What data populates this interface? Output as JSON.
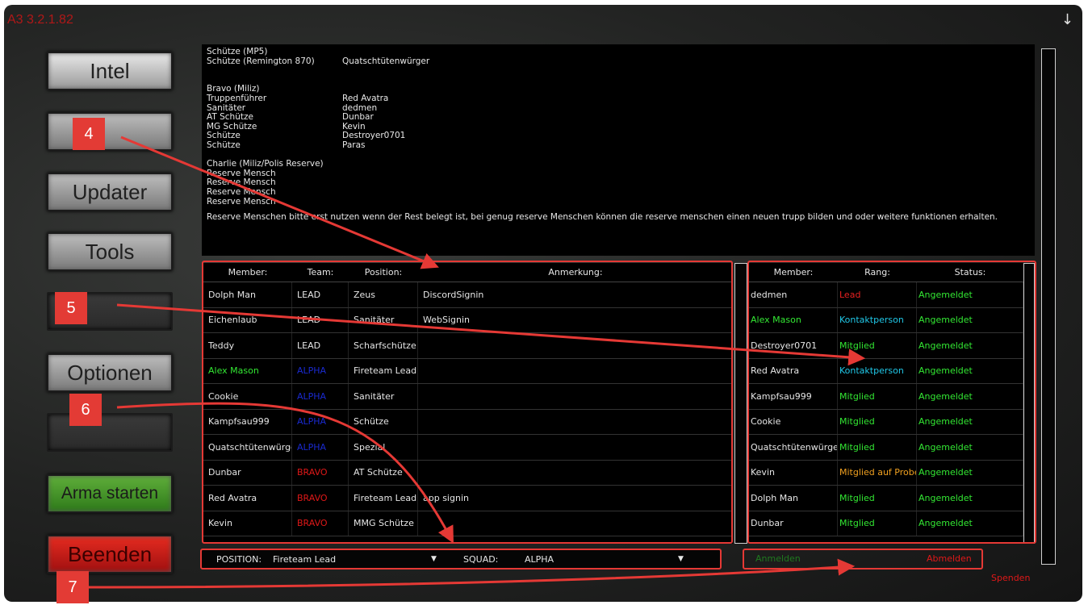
{
  "app": {
    "version": "A3 3.2.1.82"
  },
  "sidebar": [
    {
      "label": "Intel",
      "style": "light"
    },
    {
      "label": "",
      "style": "grey"
    },
    {
      "label": "Updater",
      "style": "grey"
    },
    {
      "label": "Tools",
      "style": "grey"
    },
    {
      "label": "",
      "style": "dark"
    },
    {
      "label": "Optionen",
      "style": "grey"
    },
    {
      "label": "",
      "style": "dark"
    },
    {
      "label": "Arma starten",
      "style": "green"
    },
    {
      "label": "Beenden",
      "style": "red"
    }
  ],
  "badges": [
    "4",
    "5",
    "6",
    "7"
  ],
  "info": {
    "lines": [
      {
        "role": "Schütze (MP5)",
        "name": ""
      },
      {
        "role": "Schütze (Remington 870)",
        "name": "Quatschtütenwürger"
      },
      {
        "role": "",
        "name": ""
      },
      {
        "role": "",
        "name": ""
      },
      {
        "role": "Bravo (Miliz)",
        "name": ""
      },
      {
        "role": "Truppenführer",
        "name": "Red Avatra"
      },
      {
        "role": "Sanitäter",
        "name": "dedmen"
      },
      {
        "role": "AT Schütze",
        "name": "Dunbar"
      },
      {
        "role": "MG Schütze",
        "name": "Kevin"
      },
      {
        "role": "Schütze",
        "name": "Destroyer0701"
      },
      {
        "role": "Schütze",
        "name": "Paras"
      },
      {
        "role": "",
        "name": ""
      },
      {
        "role": "Charlie (Miliz/Polis Reserve)",
        "name": ""
      },
      {
        "role": "Reserve Mensch",
        "name": ""
      },
      {
        "role": "Reserve Mensch",
        "name": ""
      },
      {
        "role": "Reserve Mensch",
        "name": ""
      },
      {
        "role": "Reserve Mensch",
        "name": ""
      }
    ],
    "note": "Reserve Menschen bitte erst nutzen wenn der Rest belegt ist, bei genug reserve Menschen können die reserve menschen einen neuen trupp bilden und oder weitere funktionen erhalten."
  },
  "roster": {
    "headers": [
      "Member:",
      "Team:",
      "Position:",
      "Anmerkung:"
    ],
    "rows": [
      {
        "member": "Dolph Man",
        "member_color": "#e6e6e6",
        "team": "LEAD",
        "team_color": "#e6e6e6",
        "position": "Zeus",
        "note": "DiscordSignin"
      },
      {
        "member": "Eichenlaub",
        "member_color": "#e6e6e6",
        "team": "LEAD",
        "team_color": "#e6e6e6",
        "position": "Sanitäter",
        "note": "WebSignin"
      },
      {
        "member": "Teddy",
        "member_color": "#e6e6e6",
        "team": "LEAD",
        "team_color": "#e6e6e6",
        "position": "Scharfschütze",
        "note": ""
      },
      {
        "member": "Alex Mason",
        "member_color": "#33e833",
        "team": "ALPHA",
        "team_color": "#1a2ad0",
        "position": "Fireteam Lead",
        "note": ""
      },
      {
        "member": "Cookie",
        "member_color": "#e6e6e6",
        "team": "ALPHA",
        "team_color": "#1a2ad0",
        "position": "Sanitäter",
        "note": ""
      },
      {
        "member": "Kampfsau999",
        "member_color": "#e6e6e6",
        "team": "ALPHA",
        "team_color": "#1a2ad0",
        "position": "Schütze",
        "note": ""
      },
      {
        "member": "Quatschtütenwürger",
        "member_color": "#e6e6e6",
        "team": "ALPHA",
        "team_color": "#1a2ad0",
        "position": "Spezial",
        "note": ""
      },
      {
        "member": "Dunbar",
        "member_color": "#e6e6e6",
        "team": "BRAVO",
        "team_color": "#e01818",
        "position": "AT Schütze",
        "note": ""
      },
      {
        "member": "Red Avatra",
        "member_color": "#e6e6e6",
        "team": "BRAVO",
        "team_color": "#e01818",
        "position": "Fireteam Lead",
        "note": "app signin"
      },
      {
        "member": "Kevin",
        "member_color": "#e6e6e6",
        "team": "BRAVO",
        "team_color": "#e01818",
        "position": "MMG Schütze",
        "note": ""
      }
    ]
  },
  "status": {
    "headers": [
      "Member:",
      "Rang:",
      "Status:"
    ],
    "rows": [
      {
        "member": "dedmen",
        "member_color": "#e6e6e6",
        "rank": "Lead",
        "rank_color": "#e82020",
        "status": "Angemeldet"
      },
      {
        "member": "Alex Mason",
        "member_color": "#33e833",
        "rank": "Kontaktperson",
        "rank_color": "#20c8e8",
        "status": "Angemeldet"
      },
      {
        "member": "Destroyer0701",
        "member_color": "#e6e6e6",
        "rank": "Mitglied",
        "rank_color": "#33e833",
        "status": "Angemeldet"
      },
      {
        "member": "Red Avatra",
        "member_color": "#e6e6e6",
        "rank": "Kontaktperson",
        "rank_color": "#20c8e8",
        "status": "Angemeldet"
      },
      {
        "member": "Kampfsau999",
        "member_color": "#e6e6e6",
        "rank": "Mitglied",
        "rank_color": "#33e833",
        "status": "Angemeldet"
      },
      {
        "member": "Cookie",
        "member_color": "#e6e6e6",
        "rank": "Mitglied",
        "rank_color": "#33e833",
        "status": "Angemeldet"
      },
      {
        "member": "Quatschtütenwürger",
        "member_color": "#e6e6e6",
        "rank": "Mitglied",
        "rank_color": "#33e833",
        "status": "Angemeldet"
      },
      {
        "member": "Kevin",
        "member_color": "#e6e6e6",
        "rank": "Mitglied auf Probe",
        "rank_color": "#f0a020",
        "status": "Angemeldet"
      },
      {
        "member": "Dolph Man",
        "member_color": "#e6e6e6",
        "rank": "Mitglied",
        "rank_color": "#33e833",
        "status": "Angemeldet"
      },
      {
        "member": "Dunbar",
        "member_color": "#e6e6e6",
        "rank": "Mitglied",
        "rank_color": "#33e833",
        "status": "Angemeldet"
      }
    ],
    "status_color": "#33e833"
  },
  "selectors": {
    "position_label": "POSITION:",
    "position_value": "Fireteam Lead",
    "squad_label": "SQUAD:",
    "squad_value": "ALPHA"
  },
  "auth": {
    "signin": "Anmelden",
    "signin_color": "#1f7a1f",
    "signout": "Abmelden",
    "signout_color": "#e01818",
    "donate": "Spenden",
    "donate_color": "#e01818"
  },
  "colors": {
    "annotation": "#e53935"
  }
}
